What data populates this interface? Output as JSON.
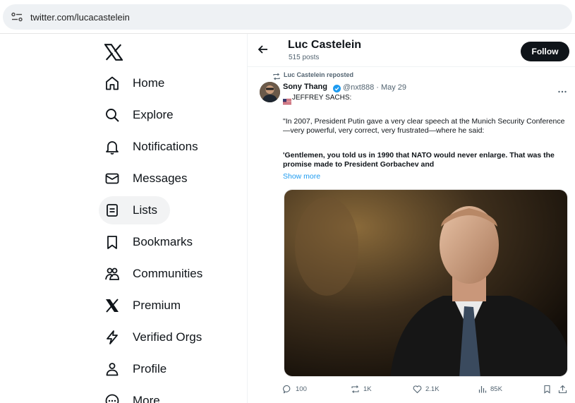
{
  "browser": {
    "url": "twitter.com/lucacastelein"
  },
  "sidebar": {
    "logo_icon": "x-logo-icon",
    "items": [
      {
        "label": "Home",
        "icon": "home-icon"
      },
      {
        "label": "Explore",
        "icon": "search-icon"
      },
      {
        "label": "Notifications",
        "icon": "bell-icon"
      },
      {
        "label": "Messages",
        "icon": "envelope-icon"
      },
      {
        "label": "Lists",
        "icon": "list-icon",
        "active": true
      },
      {
        "label": "Bookmarks",
        "icon": "bookmark-icon"
      },
      {
        "label": "Communities",
        "icon": "people-icon"
      },
      {
        "label": "Premium",
        "icon": "x-logo-icon"
      },
      {
        "label": "Verified Orgs",
        "icon": "lightning-icon"
      },
      {
        "label": "Profile",
        "icon": "person-icon"
      },
      {
        "label": "More",
        "icon": "more-circle-icon"
      }
    ]
  },
  "header": {
    "name": "Luc Castelein",
    "post_count": "515 posts",
    "follow_label": "Follow"
  },
  "tweet": {
    "repost_label": "Luc Castelein reposted",
    "author_name": "Sony Thang",
    "author_handle_date": "@nxt888 · May 29",
    "line1": "JEFFREY SACHS:",
    "quote": "\"In 2007, President Putin gave a very clear speech at the Munich Security Conference—very powerful, very correct, very frustrated—where he said:",
    "bold_quote": "'Gentlemen, you told us in 1990 that NATO would never enlarge. That was the promise made to President Gorbachev and",
    "show_more": "Show more",
    "actions": {
      "replies": "100",
      "reposts": "1K",
      "likes": "2.1K",
      "views": "85K"
    }
  },
  "colors": {
    "accent": "#1d9bf0",
    "text": "#0f1419",
    "muted": "#536471",
    "follow_bg": "#0f1419"
  }
}
